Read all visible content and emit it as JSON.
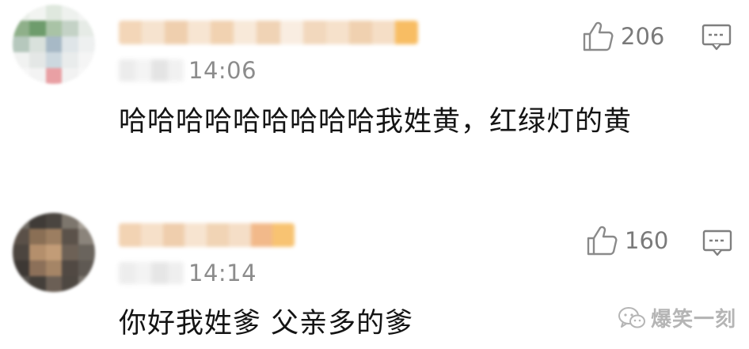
{
  "comments": [
    {
      "time": "14:06",
      "likes": "206",
      "text": "哈哈哈哈哈哈哈哈哈我姓黄，红绿灯的黄"
    },
    {
      "time": "14:14",
      "likes": "160",
      "text": "你好我姓爹  父亲多的爹"
    }
  ],
  "watermark": {
    "text": "爆笑一刻"
  },
  "colors": {
    "meta_gray": "#8c8c8c",
    "body_text": "#141414",
    "icon_gray": "#8a8a8a",
    "watermark_gray": "#b5b5b5"
  },
  "icons": [
    "thumbs-up-icon",
    "reply-icon",
    "wechat-icon"
  ]
}
